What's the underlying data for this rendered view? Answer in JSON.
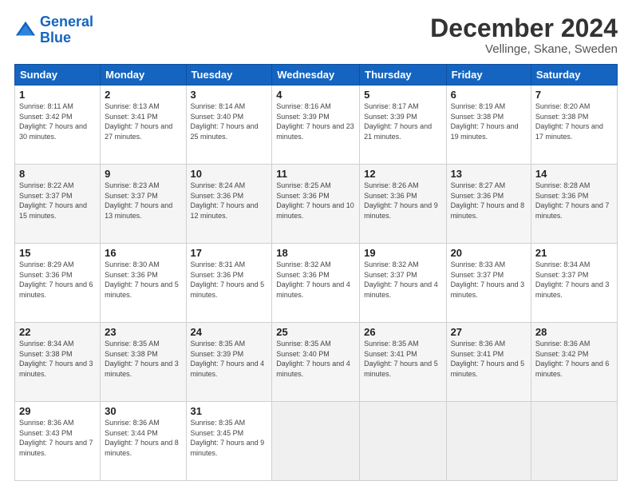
{
  "header": {
    "logo_line1": "General",
    "logo_line2": "Blue",
    "month": "December 2024",
    "location": "Vellinge, Skane, Sweden"
  },
  "weekdays": [
    "Sunday",
    "Monday",
    "Tuesday",
    "Wednesday",
    "Thursday",
    "Friday",
    "Saturday"
  ],
  "weeks": [
    [
      {
        "day": "1",
        "sunrise": "8:11 AM",
        "sunset": "3:42 PM",
        "daylight": "7 hours and 30 minutes."
      },
      {
        "day": "2",
        "sunrise": "8:13 AM",
        "sunset": "3:41 PM",
        "daylight": "7 hours and 27 minutes."
      },
      {
        "day": "3",
        "sunrise": "8:14 AM",
        "sunset": "3:40 PM",
        "daylight": "7 hours and 25 minutes."
      },
      {
        "day": "4",
        "sunrise": "8:16 AM",
        "sunset": "3:39 PM",
        "daylight": "7 hours and 23 minutes."
      },
      {
        "day": "5",
        "sunrise": "8:17 AM",
        "sunset": "3:39 PM",
        "daylight": "7 hours and 21 minutes."
      },
      {
        "day": "6",
        "sunrise": "8:19 AM",
        "sunset": "3:38 PM",
        "daylight": "7 hours and 19 minutes."
      },
      {
        "day": "7",
        "sunrise": "8:20 AM",
        "sunset": "3:38 PM",
        "daylight": "7 hours and 17 minutes."
      }
    ],
    [
      {
        "day": "8",
        "sunrise": "8:22 AM",
        "sunset": "3:37 PM",
        "daylight": "7 hours and 15 minutes."
      },
      {
        "day": "9",
        "sunrise": "8:23 AM",
        "sunset": "3:37 PM",
        "daylight": "7 hours and 13 minutes."
      },
      {
        "day": "10",
        "sunrise": "8:24 AM",
        "sunset": "3:36 PM",
        "daylight": "7 hours and 12 minutes."
      },
      {
        "day": "11",
        "sunrise": "8:25 AM",
        "sunset": "3:36 PM",
        "daylight": "7 hours and 10 minutes."
      },
      {
        "day": "12",
        "sunrise": "8:26 AM",
        "sunset": "3:36 PM",
        "daylight": "7 hours and 9 minutes."
      },
      {
        "day": "13",
        "sunrise": "8:27 AM",
        "sunset": "3:36 PM",
        "daylight": "7 hours and 8 minutes."
      },
      {
        "day": "14",
        "sunrise": "8:28 AM",
        "sunset": "3:36 PM",
        "daylight": "7 hours and 7 minutes."
      }
    ],
    [
      {
        "day": "15",
        "sunrise": "8:29 AM",
        "sunset": "3:36 PM",
        "daylight": "7 hours and 6 minutes."
      },
      {
        "day": "16",
        "sunrise": "8:30 AM",
        "sunset": "3:36 PM",
        "daylight": "7 hours and 5 minutes."
      },
      {
        "day": "17",
        "sunrise": "8:31 AM",
        "sunset": "3:36 PM",
        "daylight": "7 hours and 5 minutes."
      },
      {
        "day": "18",
        "sunrise": "8:32 AM",
        "sunset": "3:36 PM",
        "daylight": "7 hours and 4 minutes."
      },
      {
        "day": "19",
        "sunrise": "8:32 AM",
        "sunset": "3:37 PM",
        "daylight": "7 hours and 4 minutes."
      },
      {
        "day": "20",
        "sunrise": "8:33 AM",
        "sunset": "3:37 PM",
        "daylight": "7 hours and 3 minutes."
      },
      {
        "day": "21",
        "sunrise": "8:34 AM",
        "sunset": "3:37 PM",
        "daylight": "7 hours and 3 minutes."
      }
    ],
    [
      {
        "day": "22",
        "sunrise": "8:34 AM",
        "sunset": "3:38 PM",
        "daylight": "7 hours and 3 minutes."
      },
      {
        "day": "23",
        "sunrise": "8:35 AM",
        "sunset": "3:38 PM",
        "daylight": "7 hours and 3 minutes."
      },
      {
        "day": "24",
        "sunrise": "8:35 AM",
        "sunset": "3:39 PM",
        "daylight": "7 hours and 4 minutes."
      },
      {
        "day": "25",
        "sunrise": "8:35 AM",
        "sunset": "3:40 PM",
        "daylight": "7 hours and 4 minutes."
      },
      {
        "day": "26",
        "sunrise": "8:35 AM",
        "sunset": "3:41 PM",
        "daylight": "7 hours and 5 minutes."
      },
      {
        "day": "27",
        "sunrise": "8:36 AM",
        "sunset": "3:41 PM",
        "daylight": "7 hours and 5 minutes."
      },
      {
        "day": "28",
        "sunrise": "8:36 AM",
        "sunset": "3:42 PM",
        "daylight": "7 hours and 6 minutes."
      }
    ],
    [
      {
        "day": "29",
        "sunrise": "8:36 AM",
        "sunset": "3:43 PM",
        "daylight": "7 hours and 7 minutes."
      },
      {
        "day": "30",
        "sunrise": "8:36 AM",
        "sunset": "3:44 PM",
        "daylight": "7 hours and 8 minutes."
      },
      {
        "day": "31",
        "sunrise": "8:35 AM",
        "sunset": "3:45 PM",
        "daylight": "7 hours and 9 minutes."
      },
      null,
      null,
      null,
      null
    ]
  ]
}
